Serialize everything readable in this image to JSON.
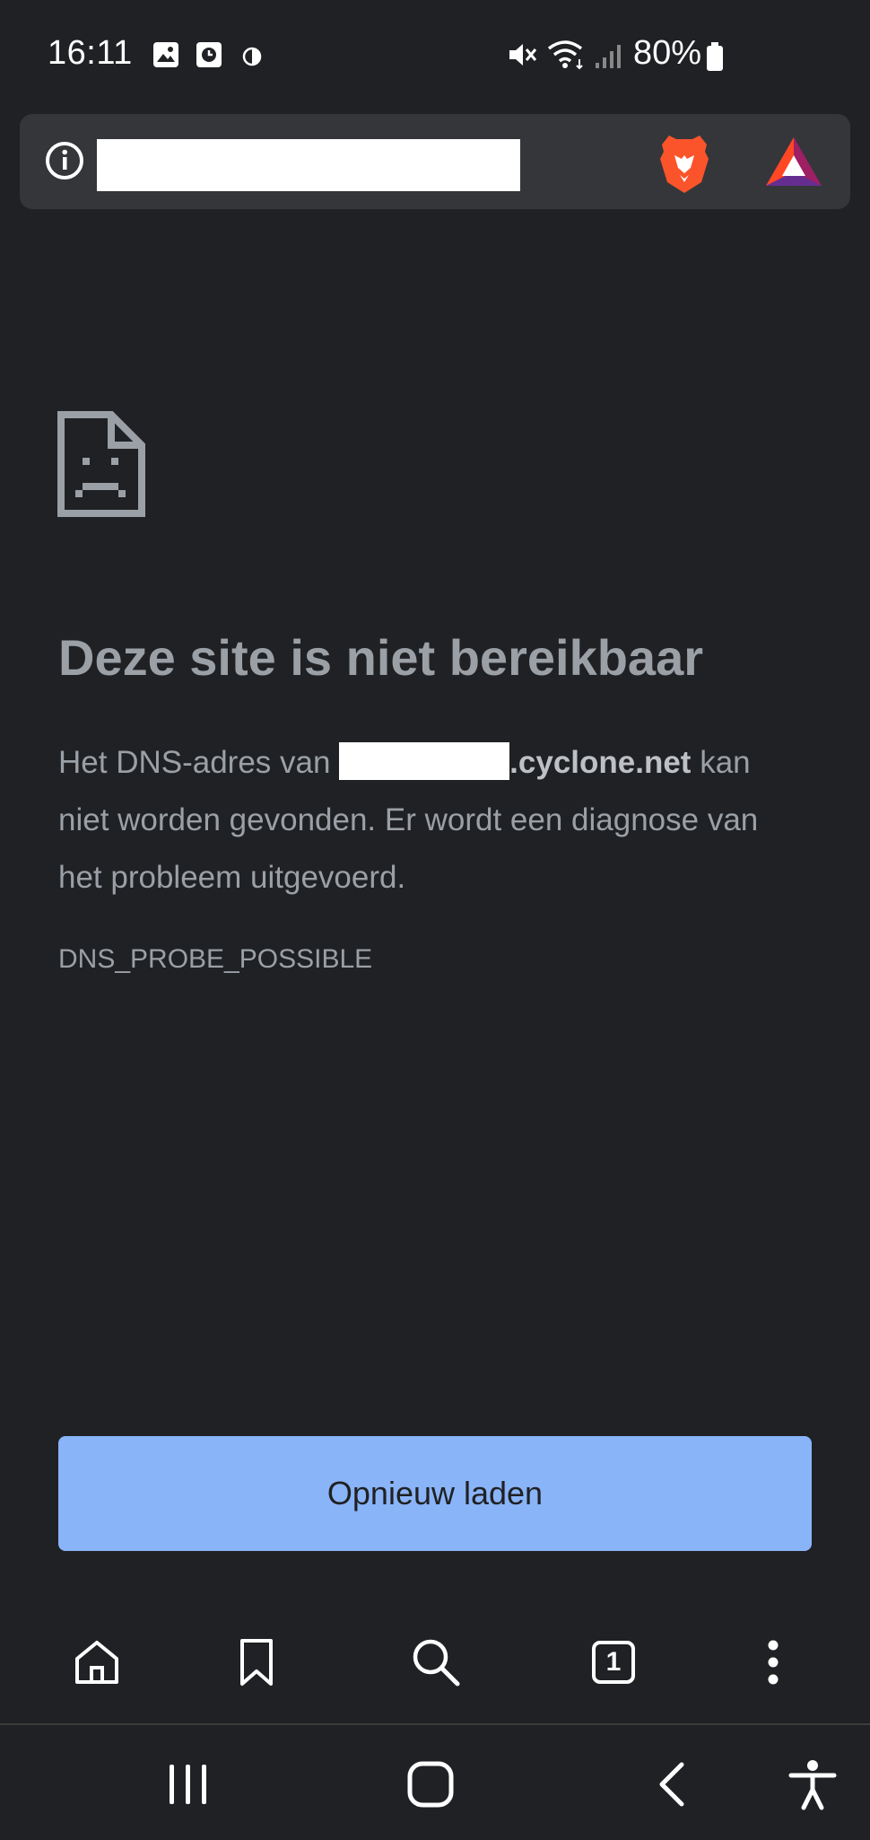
{
  "status_bar": {
    "time": "16:11",
    "battery": "80%",
    "icons": [
      "gallery-icon",
      "screen-recorder-icon",
      "data-saver-icon",
      "mute-icon",
      "wifi-icon",
      "signal-icon",
      "battery-icon"
    ]
  },
  "address_bar": {
    "icons": [
      "info-icon",
      "brave-shields-icon",
      "brave-rewards-icon"
    ]
  },
  "error_page": {
    "icon": "sad-document-icon",
    "title": "Deze site is niet bereikbaar",
    "body_prefix": "Het DNS-adres van ",
    "body_domain": ".cyclone.net",
    "body_suffix": " kan niet worden gevonden. Er wordt een diagnose van het probleem uitgevoerd.",
    "error_code": "DNS_PROBE_POSSIBLE",
    "reload_label": "Opnieuw laden"
  },
  "toolbar": {
    "items": [
      "home-icon",
      "bookmark-icon",
      "search-icon",
      "tab-switcher",
      "menu-icon"
    ],
    "tab_count": "1"
  },
  "nav_bar": {
    "items": [
      "recent-apps-icon",
      "home-icon",
      "back-icon",
      "accessibility-icon"
    ]
  },
  "colors": {
    "background": "#202124",
    "url_bar": "#35363a",
    "text": "#9aa0a6",
    "button": "#8ab4f8"
  }
}
